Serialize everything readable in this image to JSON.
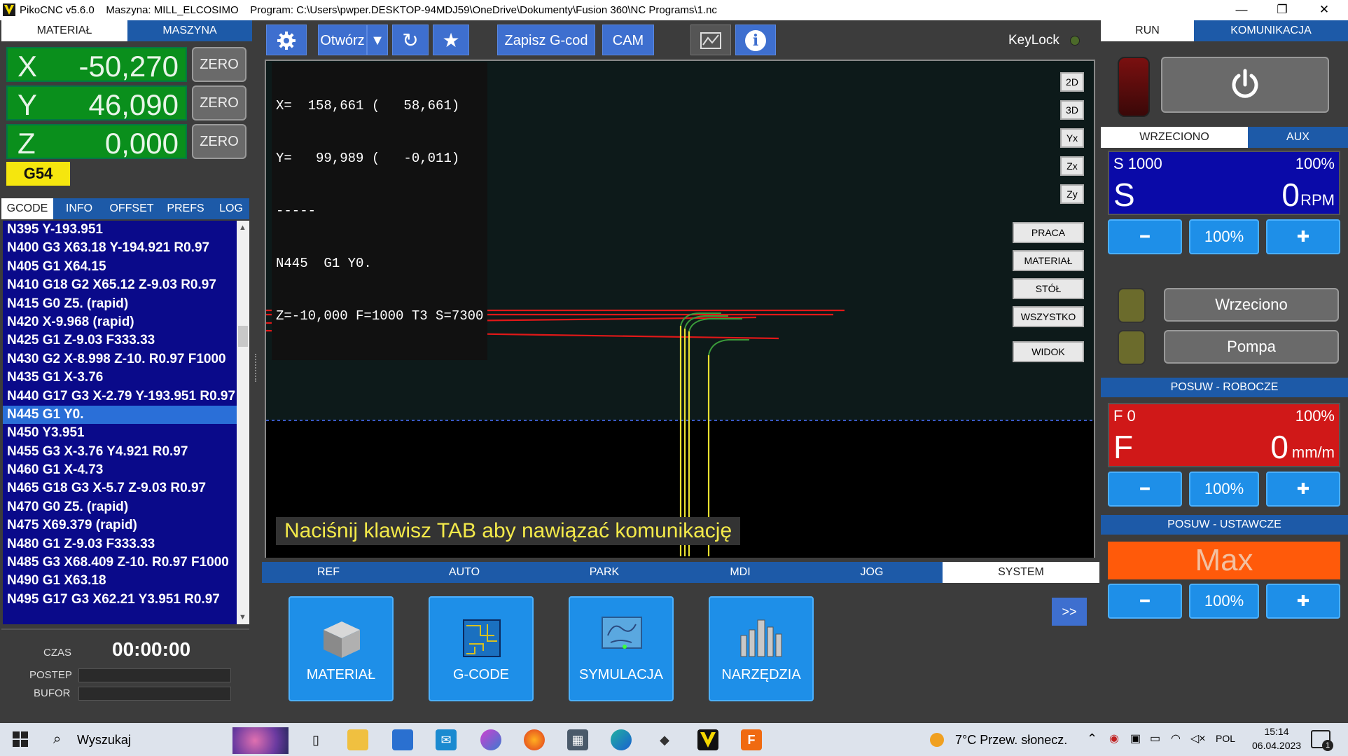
{
  "titlebar": {
    "app": "PikoCNC v5.6.0",
    "machine": "Maszyna: MILL_ELCOSIMO",
    "program": "Program: C:\\Users\\pwper.DESKTOP-94MDJ59\\OneDrive\\Dokumenty\\Fusion 360\\NC Programs\\1.nc",
    "minimize": "—",
    "restore": "❐",
    "close": "✕"
  },
  "left": {
    "tabs": [
      "MATERIAŁ",
      "MASZYNA"
    ],
    "axes": [
      {
        "label": "X",
        "value": "-50,270",
        "zero": "ZERO"
      },
      {
        "label": "Y",
        "value": "46,090",
        "zero": "ZERO"
      },
      {
        "label": "Z",
        "value": "0,000",
        "zero": "ZERO"
      }
    ],
    "wcs": "G54",
    "subtabs": [
      "GCODE",
      "INFO",
      "OFFSET",
      "PREFS",
      "LOG"
    ],
    "gcode": [
      "N395  Y-193.951",
      "N400  G3 X63.18 Y-194.921 R0.97",
      "N405  G1 X64.15",
      "N410  G18 G2 X65.12 Z-9.03 R0.97",
      "N415  G0 Z5. (rapid)",
      "N420  X-9.968 (rapid)",
      "N425  G1 Z-9.03 F333.33",
      "N430  G2 X-8.998 Z-10. R0.97 F1000",
      "N435  G1 X-3.76",
      "N440  G17 G3 X-2.79 Y-193.951 R0.97",
      "N445  G1 Y0.",
      "N450  Y3.951",
      "N455  G3 X-3.76 Y4.921 R0.97",
      "N460  G1 X-4.73",
      "N465  G18 G3 X-5.7 Z-9.03 R0.97",
      "N470  G0 Z5. (rapid)",
      "N475  X69.379 (rapid)",
      "N480  G1 Z-9.03 F333.33",
      "N485  G3 X68.409 Z-10. R0.97 F1000",
      "N490  G1 X63.18",
      "N495  G17 G3 X62.21 Y3.951 R0.97"
    ],
    "selected_line": 10,
    "footer": {
      "czas_label": "CZAS",
      "czas_value": "00:00:00",
      "postep_label": "POSTEP",
      "bufor_label": "BUFOR"
    }
  },
  "toolbar": {
    "settings_icon": "gear-icon",
    "open": "Otwórz",
    "open_arrow": "▼",
    "reload_icon": "↻",
    "favorite_icon": "★",
    "save": "Zapisz G-cod",
    "cam": "CAM",
    "chart_icon": "chart-icon",
    "info_icon": "i",
    "keylock": "KeyLock"
  },
  "viewport": {
    "readout": [
      "X=  158,661 (   58,661)",
      "Y=   99,989 (   -0,011)",
      "-----",
      "N445  G1 Y0.",
      "Z=-10,000 F=1000 T3 S=7300"
    ],
    "view_buttons": [
      "2D",
      "3D",
      "Yx",
      "Zx",
      "Zy"
    ],
    "zoom_buttons": [
      "PRACA",
      "MATERIAŁ",
      "STÓŁ",
      "WSZYSTKO"
    ],
    "widok": "WIDOK",
    "message": "Naciśnij klawisz TAB aby nawiązać komunikację"
  },
  "modes": [
    "REF",
    "AUTO",
    "PARK",
    "MDI",
    "JOG",
    "SYSTEM"
  ],
  "big_buttons": [
    "MATERIAŁ",
    "G-CODE",
    "SYMULACJA",
    "NARZĘDZIA"
  ],
  "more": ">>",
  "right": {
    "tabs": [
      "RUN",
      "KOMUNIKACJA"
    ],
    "spindle_tabs": [
      "WRZECIONO",
      "AUX"
    ],
    "spindle": {
      "s_set": "S 1000",
      "pct": "100%",
      "letter": "S",
      "value": "0",
      "unit": "RPM"
    },
    "spindle_pct_btn": "100%",
    "wrzeciono": "Wrzeciono",
    "pompa": "Pompa",
    "feed_header": "POSUW - ROBOCZE",
    "feed": {
      "f_set": "F 0",
      "pct": "100%",
      "letter": "F",
      "value": "0",
      "unit": "mm/m"
    },
    "feed_pct_btn": "100%",
    "rapid_header": "POSUW - USTAWCZE",
    "rapid_value": "Max",
    "rapid_pct_btn": "100%",
    "minus": "━",
    "plus": "✚"
  },
  "taskbar": {
    "search": "Wyszukaj",
    "weather": "7°C  Przew. słonecz.",
    "lang": "POL",
    "time": "15:14",
    "date": "06.04.2023",
    "notif_count": "1"
  },
  "colors": {
    "accent_blue": "#1d5aa8",
    "axis_green": "#0a8f1c",
    "wcs_yellow": "#f5e60e",
    "rapid_orange": "#ff5a0a",
    "feed_red": "#d01818",
    "spindle_blue": "#0a0aa8"
  }
}
